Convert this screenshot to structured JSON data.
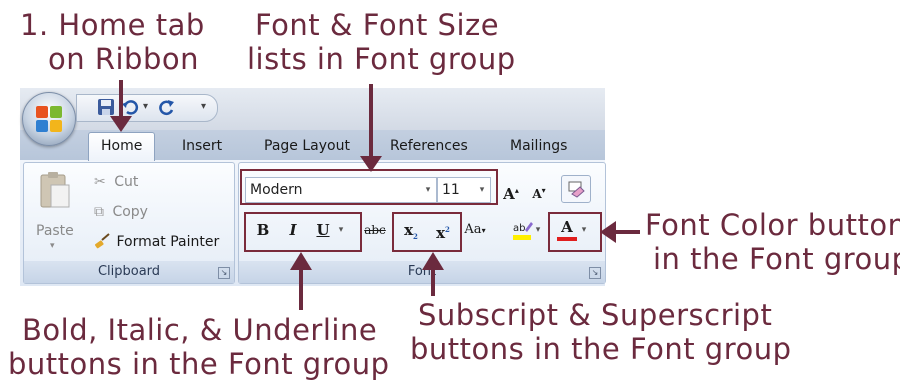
{
  "callouts": {
    "home_tab": [
      "1. Home tab",
      "on Ribbon"
    ],
    "font_lists": [
      "Font & Font Size",
      "lists in Font group"
    ],
    "font_color": [
      "Font Color button",
      "in the Font group"
    ],
    "bold_italic": [
      "Bold, Italic, & Underline",
      "buttons in the Font group"
    ],
    "sub_super": [
      "Subscript & Superscript",
      "buttons in the Font group"
    ]
  },
  "tabs": [
    "Home",
    "Insert",
    "Page Layout",
    "References",
    "Mailings"
  ],
  "clipboard": {
    "paste": "Paste",
    "cut": "Cut",
    "copy": "Copy",
    "format_painter": "Format Painter",
    "label": "Clipboard"
  },
  "font_group": {
    "font_name": "Modern",
    "font_size": "11",
    "label": "Font"
  },
  "qat": {
    "separator": "▾"
  },
  "colors": {
    "callout": "#6b2a3e",
    "arrow": "#6b2a3e",
    "highlight_box": "#7a2b3b"
  },
  "icons": [
    "office-logo",
    "save-icon",
    "undo-icon",
    "redo-icon",
    "scissors-icon",
    "copy-icon",
    "paintbrush-icon",
    "grow-font-icon",
    "shrink-font-icon",
    "clear-format-icon",
    "highlight-icon",
    "font-color-icon",
    "dialog-launcher-icon"
  ]
}
